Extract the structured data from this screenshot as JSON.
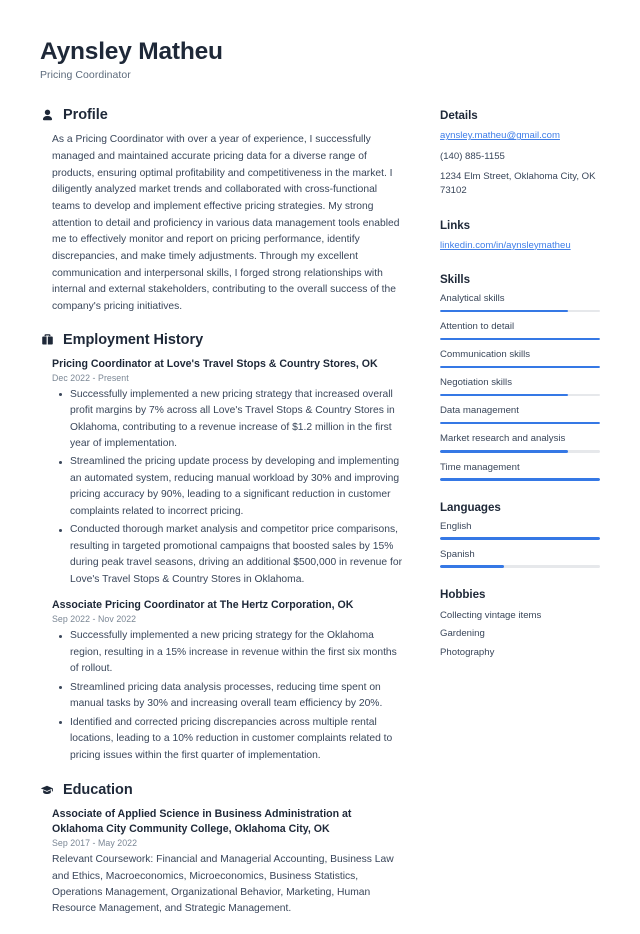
{
  "header": {
    "name": "Aynsley Matheu",
    "title": "Pricing Coordinator"
  },
  "colors": {
    "accent": "#3578e5",
    "link": "#3f7ee8",
    "heading": "#1e2838",
    "body": "#39465a",
    "muted": "#7b8795",
    "track": "#e6e8eb"
  },
  "sections": {
    "profile": {
      "icon": "person-icon",
      "title": "Profile",
      "text": "As a Pricing Coordinator with over a year of experience, I successfully managed and maintained accurate pricing data for a diverse range of products, ensuring optimal profitability and competitiveness in the market. I diligently analyzed market trends and collaborated with cross-functional teams to develop and implement effective pricing strategies. My strong attention to detail and proficiency in various data management tools enabled me to effectively monitor and report on pricing performance, identify discrepancies, and make timely adjustments. Through my excellent communication and interpersonal skills, I forged strong relationships with internal and external stakeholders, contributing to the overall success of the company's pricing initiatives."
    },
    "employment": {
      "icon": "briefcase-icon",
      "title": "Employment History",
      "entries": [
        {
          "title": "Pricing Coordinator at Love's Travel Stops & Country Stores, OK",
          "date": "Dec 2022 - Present",
          "bullets": [
            "Successfully implemented a new pricing strategy that increased overall profit margins by 7% across all Love's Travel Stops & Country Stores in Oklahoma, contributing to a revenue increase of $1.2 million in the first year of implementation.",
            "Streamlined the pricing update process by developing and implementing an automated system, reducing manual workload by 30% and improving pricing accuracy by 90%, leading to a significant reduction in customer complaints related to incorrect pricing.",
            "Conducted thorough market analysis and competitor price comparisons, resulting in targeted promotional campaigns that boosted sales by 15% during peak travel seasons, driving an additional $500,000 in revenue for Love's Travel Stops & Country Stores in Oklahoma."
          ]
        },
        {
          "title": "Associate Pricing Coordinator at The Hertz Corporation, OK",
          "date": "Sep 2022 - Nov 2022",
          "bullets": [
            "Successfully implemented a new pricing strategy for the Oklahoma region, resulting in a 15% increase in revenue within the first six months of rollout.",
            "Streamlined pricing data analysis processes, reducing time spent on manual tasks by 30% and increasing overall team efficiency by 20%.",
            "Identified and corrected pricing discrepancies across multiple rental locations, leading to a 10% reduction in customer complaints related to pricing issues within the first quarter of implementation."
          ]
        }
      ]
    },
    "education": {
      "icon": "graduation-cap-icon",
      "title": "Education",
      "entries": [
        {
          "title": "Associate of Applied Science in Business Administration at Oklahoma City Community College, Oklahoma City, OK",
          "date": "Sep 2017 - May 2022",
          "description": "Relevant Coursework: Financial and Managerial Accounting, Business Law and Ethics, Macroeconomics, Microeconomics, Business Statistics, Operations Management, Organizational Behavior, Marketing, Human Resource Management, and Strategic Management."
        }
      ]
    }
  },
  "sidebar": {
    "details": {
      "title": "Details",
      "email": "aynsley.matheu@gmail.com",
      "phone": "(140) 885-1155",
      "address": "1234 Elm Street, Oklahoma City, OK 73102"
    },
    "links": {
      "title": "Links",
      "items": [
        {
          "label": "linkedin.com/in/aynsleymatheu"
        }
      ]
    },
    "skills": {
      "title": "Skills",
      "items": [
        {
          "label": "Analytical skills",
          "level": 80
        },
        {
          "label": "Attention to detail",
          "level": 100
        },
        {
          "label": "Communication skills",
          "level": 100
        },
        {
          "label": "Negotiation skills",
          "level": 80
        },
        {
          "label": "Data management",
          "level": 100
        },
        {
          "label": "Market research and analysis",
          "level": 80
        },
        {
          "label": "Time management",
          "level": 100
        }
      ]
    },
    "languages": {
      "title": "Languages",
      "items": [
        {
          "label": "English",
          "level": 100
        },
        {
          "label": "Spanish",
          "level": 40
        }
      ]
    },
    "hobbies": {
      "title": "Hobbies",
      "items": [
        {
          "label": "Collecting vintage items"
        },
        {
          "label": "Gardening"
        },
        {
          "label": "Photography"
        }
      ]
    }
  }
}
